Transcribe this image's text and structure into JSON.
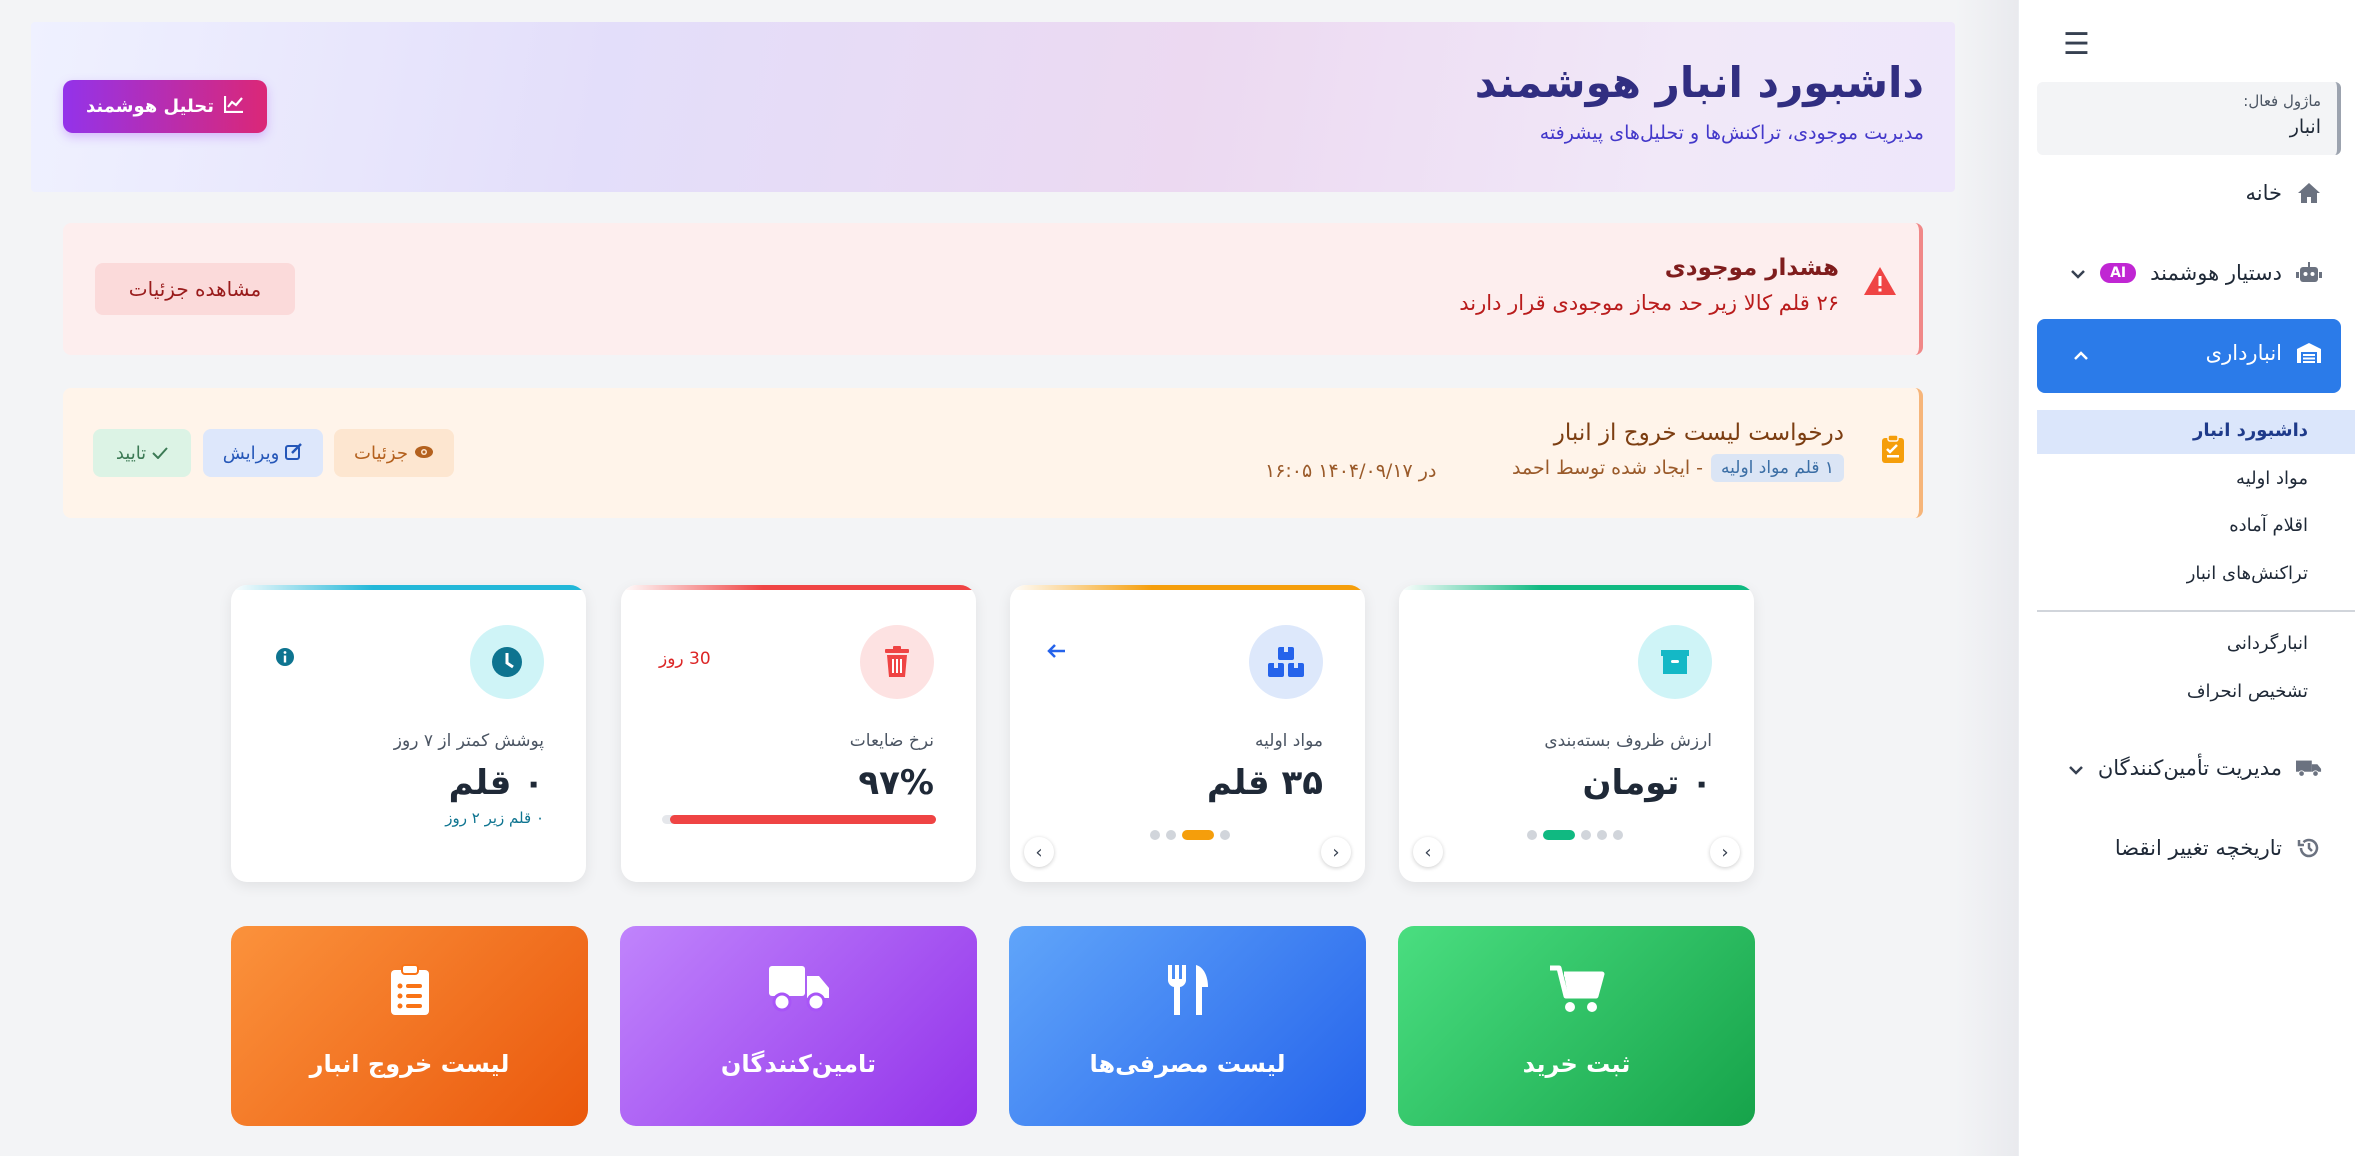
{
  "header": {
    "title": "داشبورد انبار هوشمند",
    "subtitle": "مدیریت موجودی، تراکنش‌ها و تحلیل‌های پیشرفته",
    "ai_button": "تحلیل هوشمند"
  },
  "alert": {
    "title": "هشدار موجودی",
    "text": "۲۶ قلم کالا زیر حد مجاز موجودی قرار دارند",
    "button": "مشاهده جزئیات"
  },
  "request": {
    "title": "درخواست لیست خروج از انبار",
    "badge": "۱ قلم مواد اولیه",
    "created": "- ایجاد شده توسط احمد",
    "date": "در ۱۴۰۴/۰۹/۱۷ ۱۶:۰۵",
    "buttons": {
      "details": "جزئیات",
      "edit": "ویرایش",
      "approve": "تایید"
    }
  },
  "cards": [
    {
      "label": "ارزش ظروف بسته‌بندی",
      "value": "۰ تومان"
    },
    {
      "label": "مواد اولیه",
      "value": "۳۵ قلم"
    },
    {
      "label": "نرخ ضایعات",
      "value": "۹۷%",
      "period": "30 روز",
      "progress": 0.97
    },
    {
      "label": "پوشش کمتر از ۷ روز",
      "value": "۰ قلم",
      "note": "۰ قلم زیر ۲ روز"
    }
  ],
  "tiles": [
    {
      "label": "ثبت خرید",
      "icon": "cart-icon"
    },
    {
      "label": "لیست مصرفی‌ها",
      "icon": "utensils-icon"
    },
    {
      "label": "تامین‌کنندگان",
      "icon": "truck-icon"
    },
    {
      "label": "لیست خروج انبار",
      "icon": "clipboard-list-icon"
    }
  ],
  "sidebar": {
    "module_label": "ماژول فعال:",
    "module_value": "انبار",
    "items": {
      "home": "خانه",
      "ai_assistant": "دستیار هوشمند",
      "ai_badge": "AI",
      "warehouse": "انبارداری",
      "suppliers": "مدیریت تأمین‌کنندگان",
      "expiry": "تاریخچه تغییر انقضا"
    },
    "sub_items": [
      "داشبورد انبار",
      "مواد اولیه",
      "اقلام آماده",
      "تراکنش‌های انبار",
      "انبارگردانی",
      "تشخیص انحراف"
    ]
  },
  "colors": {
    "primary": "#2b7be9",
    "title": "#312e81",
    "danger": "#ef4444",
    "success": "#10b981",
    "orange": "#f59e0b"
  }
}
